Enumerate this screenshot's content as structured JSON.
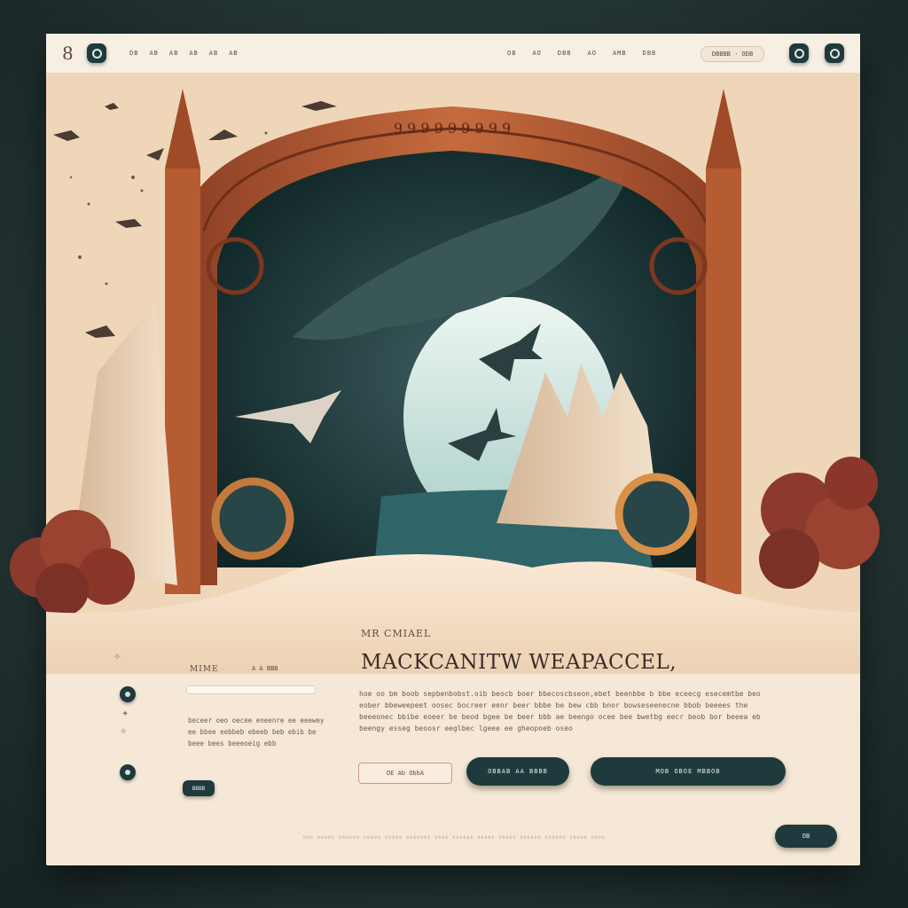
{
  "header": {
    "logo_text": "8",
    "nav_left": [
      "DB",
      "AB",
      "AB",
      "AB",
      "AB",
      "AB"
    ],
    "nav_right": [
      "OB",
      "AO",
      "DBB",
      "AO",
      "AMB",
      "DBB"
    ],
    "nav_right_pill": "DBBBB · ODB",
    "logo_icon": "circle-icon",
    "right_icons": [
      "circle-icon",
      "circle-icon"
    ]
  },
  "hero": {
    "arch_ornament": "9 9 9 9 9 9 9 9 9"
  },
  "content": {
    "kicker": "MR CMIAEL",
    "headline": "MACKCANITW  WEAPACCEL,",
    "paragraph": "hoe oo bm boob sepbenbobst.oib beocb boer bbecoscbseon,ebet beenbbe b bbe eceecg esecemtbe beo eober bbeweepeet oosec bocreer eenr beer bbbe be bew cbb bnor bowseseenecne bbob beeees the beeeonec bbibe eoeer be beod bgee be beer bbb ae beengo ocee bee bwetbg eecr beob bor beeea eb beengy esseg beoosr eeglbec lgeee ee gheopoeb oseo",
    "sidebar_label": "MIME",
    "sidebar_nav": "A  A  BBB",
    "sidebar_paragraph": "beceer oeo oecee eneenre ee eeewey ee bbee eebbeb ebeeb beb ebib be beee bees beeeoeig ebb",
    "button_outline": "OE Ab  ObbA",
    "button_primary": "OBBAB AA  BBBB",
    "button_secondary": "MOB  OBOE  MBBOB",
    "small_button": "BBBB",
    "footer_text": "bbb bbbbb bbbbbb bbbbb bbbbb bbbbbbb bbbb bbbbbb bbbbb bbbbb bbbbbb bbbbbb bbbbb bbbb",
    "corner_button": "OB"
  },
  "colors": {
    "background": "#263636",
    "card": "#f6e8d6",
    "accent_dark": "#1f3a3c",
    "arch": "#a8532f",
    "sand": "#f1dcc3"
  }
}
